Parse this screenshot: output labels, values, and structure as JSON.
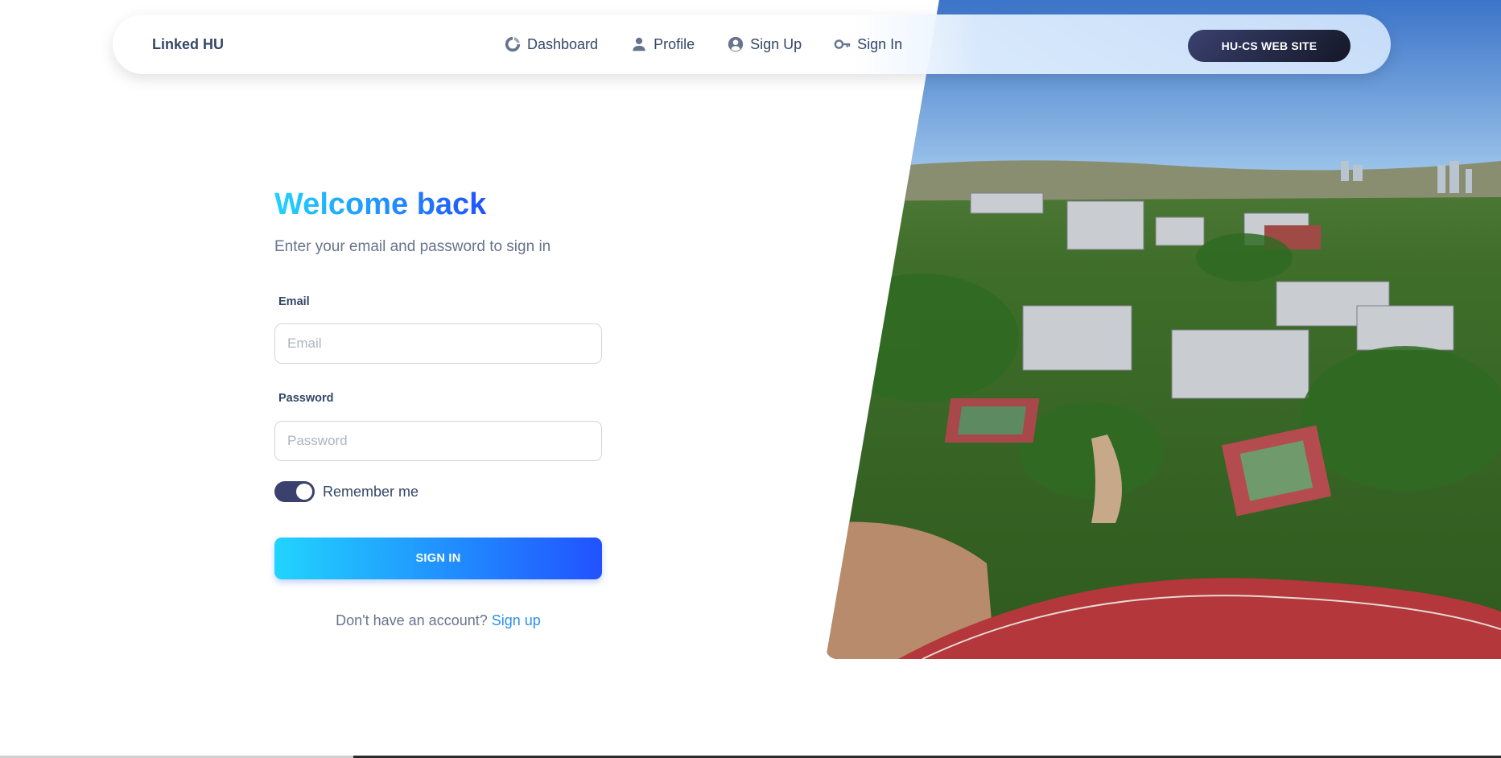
{
  "navbar": {
    "brand": "Linked HU",
    "links": [
      {
        "label": "Dashboard",
        "icon": "dashboard-icon"
      },
      {
        "label": "Profile",
        "icon": "user-icon"
      },
      {
        "label": "Sign Up",
        "icon": "user-circle-icon"
      },
      {
        "label": "Sign In",
        "icon": "key-icon"
      }
    ],
    "site_button": "HU-CS WEB SITE"
  },
  "form": {
    "title": "Welcome back",
    "subtitle": "Enter your email and password to sign in",
    "email_label": "Email",
    "email_placeholder": "Email",
    "email_value": "",
    "password_label": "Password",
    "password_placeholder": "Password",
    "password_value": "",
    "remember_label": "Remember me",
    "remember_checked": true,
    "submit_label": "SIGN IN",
    "footer_prompt": "Don't have an account?",
    "footer_link": "Sign up"
  },
  "colors": {
    "accent_gradient_start": "#21d4fd",
    "accent_gradient_end": "#2152ff",
    "dark": "#344767",
    "muted": "#67748e",
    "toggle": "#3a416f"
  }
}
